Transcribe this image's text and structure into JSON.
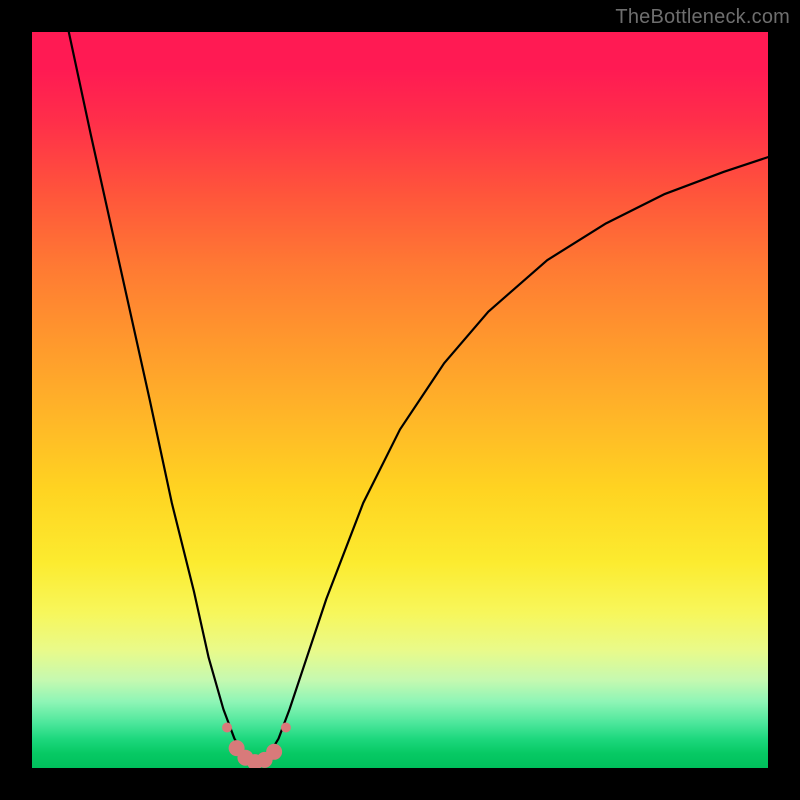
{
  "watermark": "TheBottleneck.com",
  "chart_data": {
    "type": "line",
    "title": "",
    "xlabel": "",
    "ylabel": "",
    "xlim": [
      0,
      100
    ],
    "ylim": [
      0,
      100
    ],
    "grid": false,
    "legend": false,
    "series": [
      {
        "name": "curve",
        "color": "#000000",
        "x": [
          5,
          8,
          12,
          16,
          19,
          22,
          24,
          26,
          27.5,
          29,
          30.5,
          32,
          33.5,
          35,
          37,
          40,
          45,
          50,
          56,
          62,
          70,
          78,
          86,
          94,
          100
        ],
        "y": [
          100,
          86,
          68,
          50,
          36,
          24,
          15,
          8,
          4,
          1.5,
          0.5,
          1.5,
          4,
          8,
          14,
          23,
          36,
          46,
          55,
          62,
          69,
          74,
          78,
          81,
          83
        ]
      }
    ],
    "markers": {
      "color": "#d87a7a",
      "size_large": 8,
      "size_small": 5,
      "points": [
        {
          "x": 26.5,
          "y": 5.5,
          "r": "small"
        },
        {
          "x": 27.8,
          "y": 2.7,
          "r": "large"
        },
        {
          "x": 29.0,
          "y": 1.4,
          "r": "large"
        },
        {
          "x": 30.3,
          "y": 0.8,
          "r": "large"
        },
        {
          "x": 31.6,
          "y": 1.1,
          "r": "large"
        },
        {
          "x": 32.9,
          "y": 2.2,
          "r": "large"
        },
        {
          "x": 34.5,
          "y": 5.5,
          "r": "small"
        }
      ]
    }
  }
}
